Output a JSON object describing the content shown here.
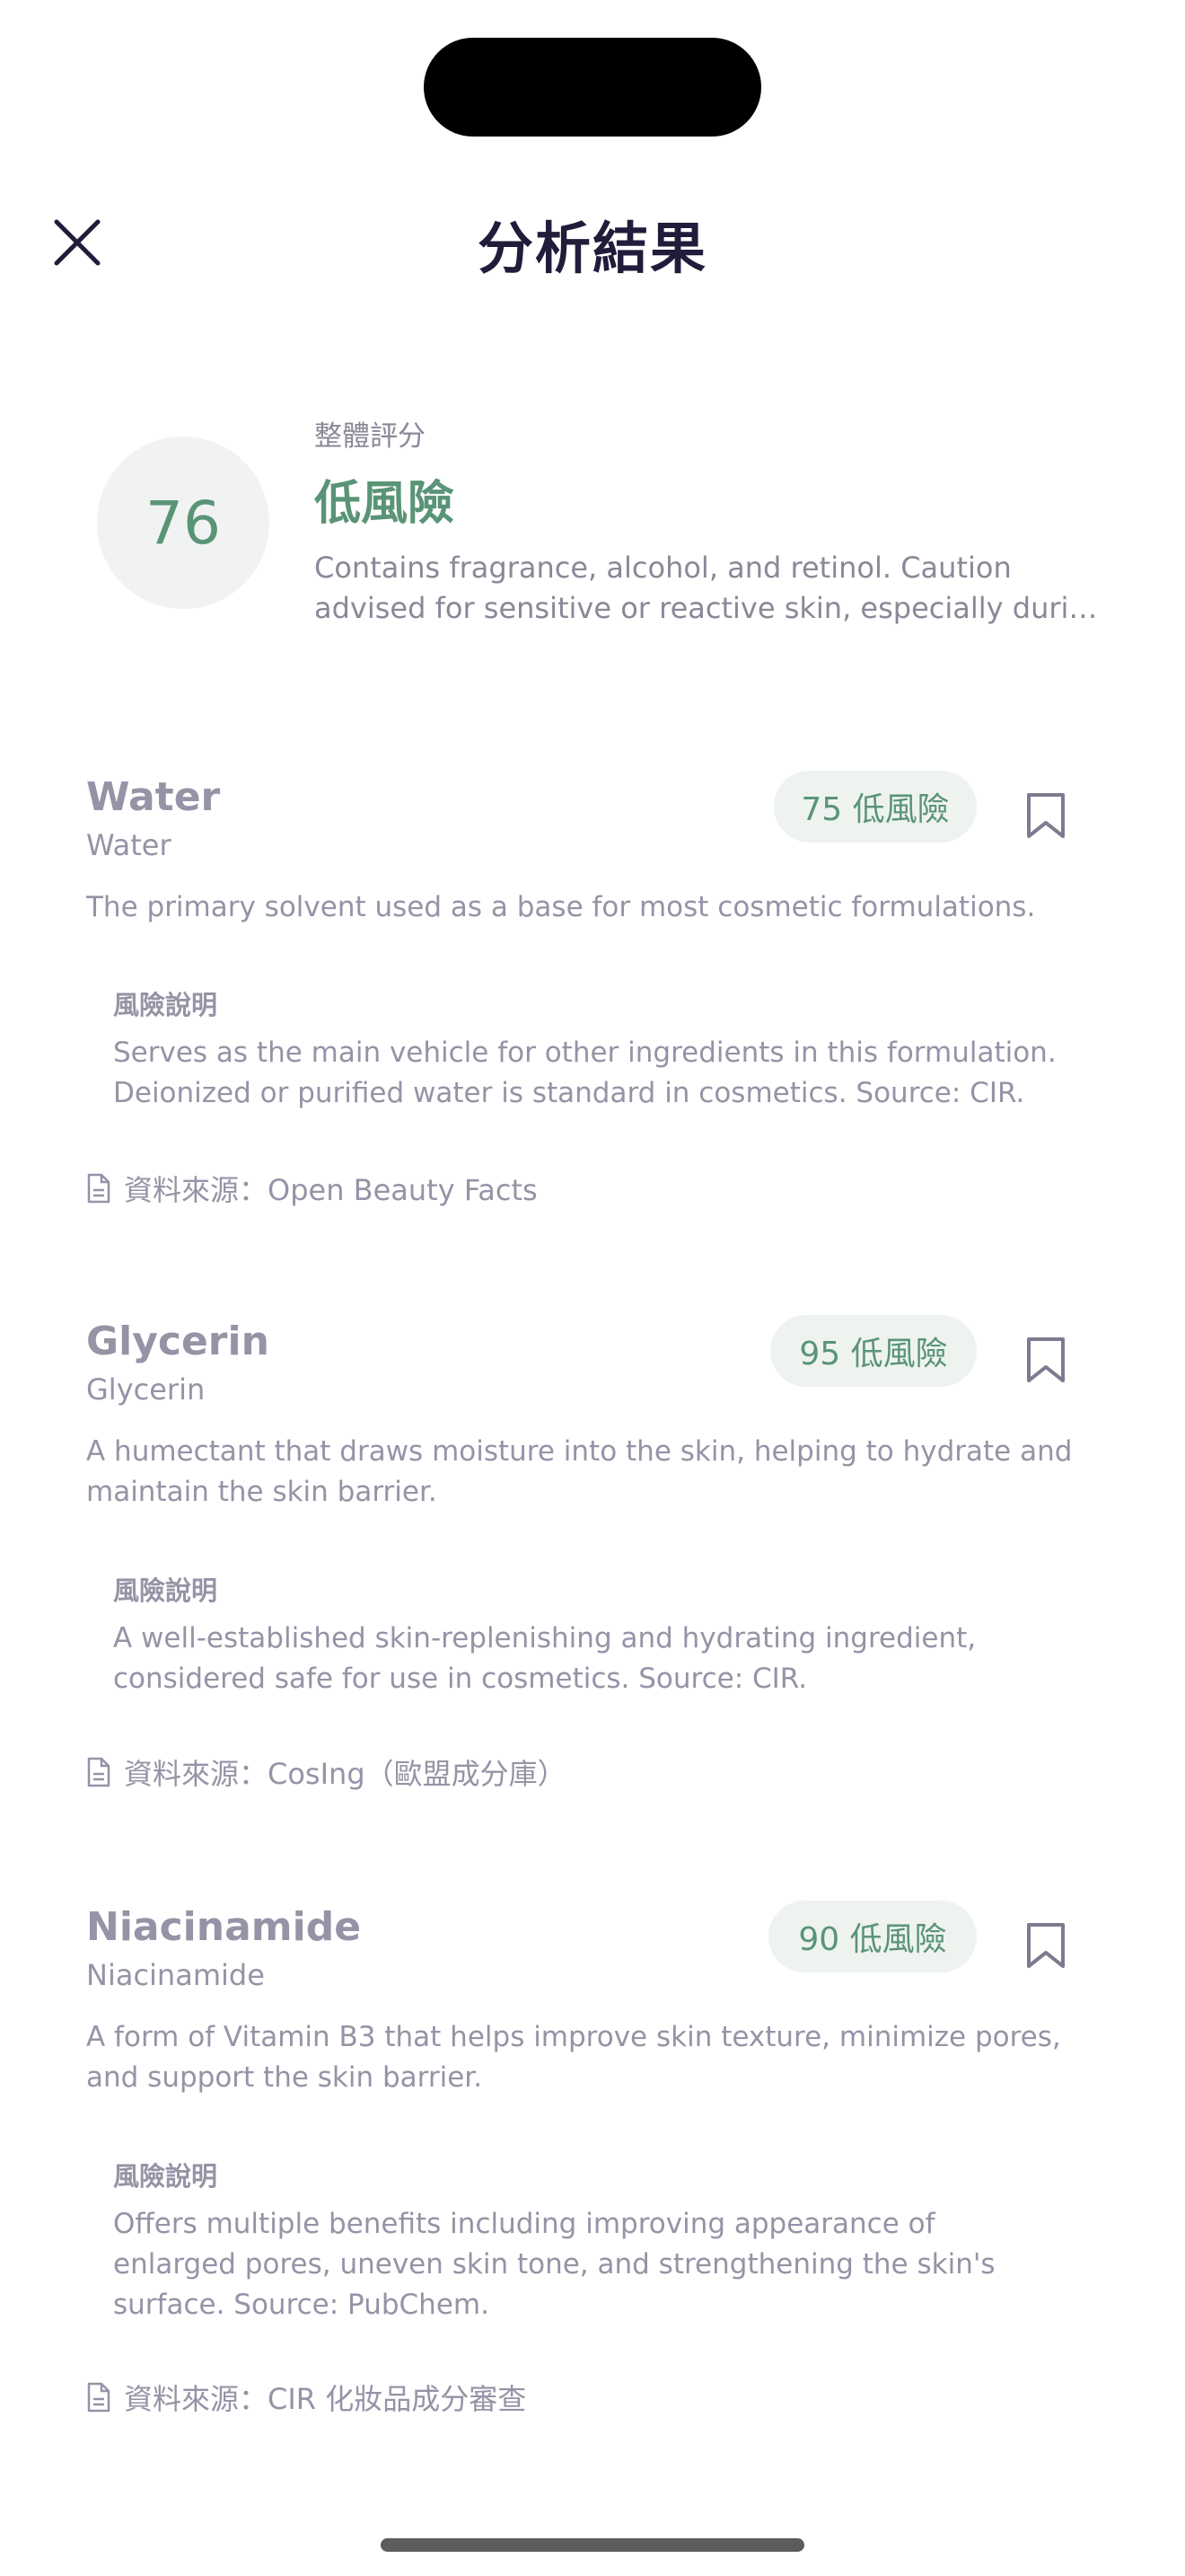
{
  "header": {
    "title": "分析結果"
  },
  "summary": {
    "score": "76",
    "label": "整體評分",
    "level": "低風險",
    "desc_line1": "Contains fragrance, alcohol, and retinol. Caution",
    "desc_line2": "advised for sensitive or reactive skin, especially durin..."
  },
  "risk_heading": "風險說明",
  "ingredients": [
    {
      "name": "Water",
      "subtitle": "Water",
      "badge": "75 低風險",
      "description": "The primary solvent used as a base for most cosmetic formulations.",
      "risk_line1": "Serves as the main vehicle for other ingredients in this formulation.",
      "risk_line2": "Deionized or purified water is standard in cosmetics. Source: CIR.",
      "source": "資料來源：Open Beauty Facts"
    },
    {
      "name": "Glycerin",
      "subtitle": "Glycerin",
      "badge": "95 低風險",
      "desc_line1": "A humectant that draws moisture into the skin, helping to hydrate and",
      "desc_line2": "maintain the skin barrier.",
      "risk_line1": "A well-established skin-replenishing and hydrating ingredient,",
      "risk_line2": "considered safe for use in cosmetics. Source: CIR.",
      "source": "資料來源：CosIng（歐盟成分庫）"
    },
    {
      "name": "Niacinamide",
      "subtitle": "Niacinamide",
      "badge": "90 低風險",
      "desc_line1": "A form of Vitamin B3 that helps improve skin texture, minimize pores,",
      "desc_line2": "and support the skin barrier.",
      "risk_line1": "Offers multiple benefits including improving appearance of",
      "risk_line2": "enlarged pores, uneven skin tone, and strengthening the skin's",
      "risk_line3": "surface. Source: PubChem.",
      "source": "資料來源：CIR 化妝品成分審查"
    }
  ],
  "colors": {
    "accent_green": "#5a9477",
    "muted_text": "#9593a6",
    "title": "#1f1d3a"
  },
  "icons": {
    "close": "close-icon",
    "bookmark": "bookmark-icon",
    "document": "document-icon"
  }
}
